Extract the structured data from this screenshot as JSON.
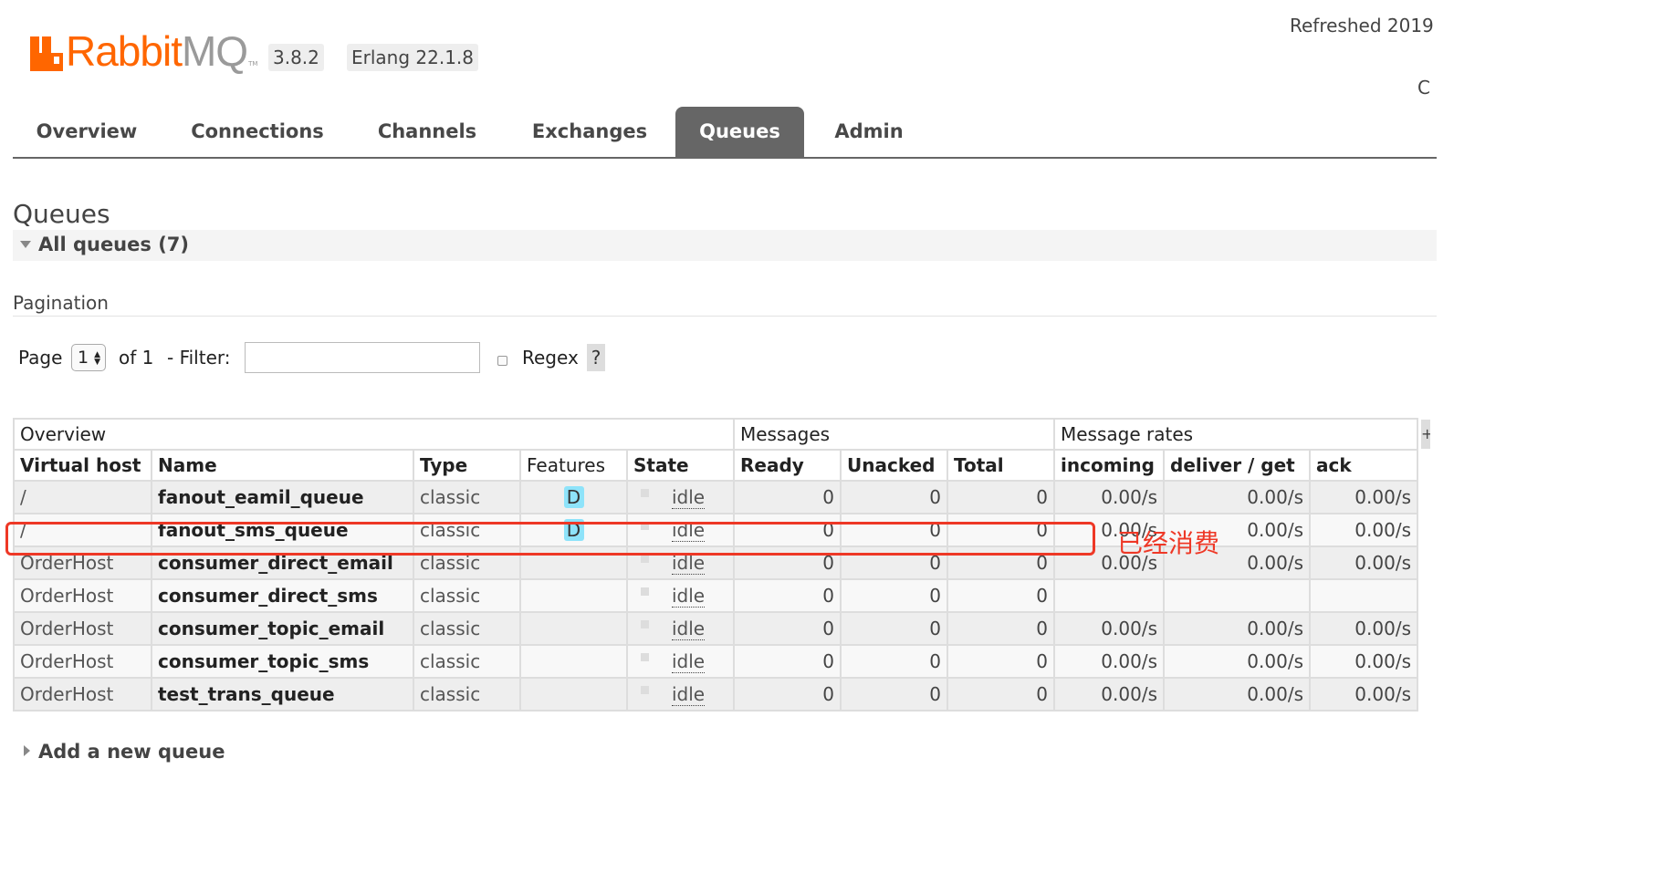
{
  "app": {
    "logo_brand": "Rabbit",
    "logo_suffix": "MQ",
    "logo_tm": "TM",
    "version": "3.8.2",
    "erlang": "Erlang 22.1.8",
    "refreshed_text": "Refreshed 2019",
    "cluster_partial": "C",
    "brand_color": "#ff6600"
  },
  "tabs": [
    {
      "label": "Overview"
    },
    {
      "label": "Connections"
    },
    {
      "label": "Channels"
    },
    {
      "label": "Exchanges"
    },
    {
      "label": "Queues",
      "active": true
    },
    {
      "label": "Admin"
    }
  ],
  "page": {
    "title": "Queues",
    "section_title": "All queues (7)",
    "pagination_heading": "Pagination",
    "page_label": "Page",
    "page_value": "1",
    "of_label": "of 1",
    "filter_label": "- Filter:",
    "filter_value": "",
    "regex_label": "Regex",
    "help_label": "?",
    "plus_label": "+",
    "add_queue": "Add a new queue"
  },
  "table": {
    "groups": [
      "Overview",
      "Messages",
      "Message rates"
    ],
    "columns": [
      "Virtual host",
      "Name",
      "Type",
      "Features",
      "State",
      "Ready",
      "Unacked",
      "Total",
      "incoming",
      "deliver / get",
      "ack"
    ],
    "rows": [
      {
        "vhost": "/",
        "name": "fanout_eamil_queue",
        "type": "classic",
        "features": "D",
        "state": "idle",
        "ready": "0",
        "unacked": "0",
        "total": "0",
        "incoming": "0.00/s",
        "deliver": "0.00/s",
        "ack": "0.00/s"
      },
      {
        "vhost": "/",
        "name": "fanout_sms_queue",
        "type": "classic",
        "features": "D",
        "state": "idle",
        "ready": "0",
        "unacked": "0",
        "total": "0",
        "incoming": "0.00/s",
        "deliver": "0.00/s",
        "ack": "0.00/s"
      },
      {
        "vhost": "OrderHost",
        "name": "consumer_direct_email",
        "type": "classic",
        "features": "",
        "state": "idle",
        "ready": "0",
        "unacked": "0",
        "total": "0",
        "incoming": "0.00/s",
        "deliver": "0.00/s",
        "ack": "0.00/s"
      },
      {
        "vhost": "OrderHost",
        "name": "consumer_direct_sms",
        "type": "classic",
        "features": "",
        "state": "idle",
        "ready": "0",
        "unacked": "0",
        "total": "0",
        "incoming": "",
        "deliver": "",
        "ack": ""
      },
      {
        "vhost": "OrderHost",
        "name": "consumer_topic_email",
        "type": "classic",
        "features": "",
        "state": "idle",
        "ready": "0",
        "unacked": "0",
        "total": "0",
        "incoming": "0.00/s",
        "deliver": "0.00/s",
        "ack": "0.00/s"
      },
      {
        "vhost": "OrderHost",
        "name": "consumer_topic_sms",
        "type": "classic",
        "features": "",
        "state": "idle",
        "ready": "0",
        "unacked": "0",
        "total": "0",
        "incoming": "0.00/s",
        "deliver": "0.00/s",
        "ack": "0.00/s"
      },
      {
        "vhost": "OrderHost",
        "name": "test_trans_queue",
        "type": "classic",
        "features": "",
        "state": "idle",
        "ready": "0",
        "unacked": "0",
        "total": "0",
        "incoming": "0.00/s",
        "deliver": "0.00/s",
        "ack": "0.00/s"
      }
    ]
  },
  "annotation": {
    "text": "已经消费",
    "color": "#ee3826"
  }
}
